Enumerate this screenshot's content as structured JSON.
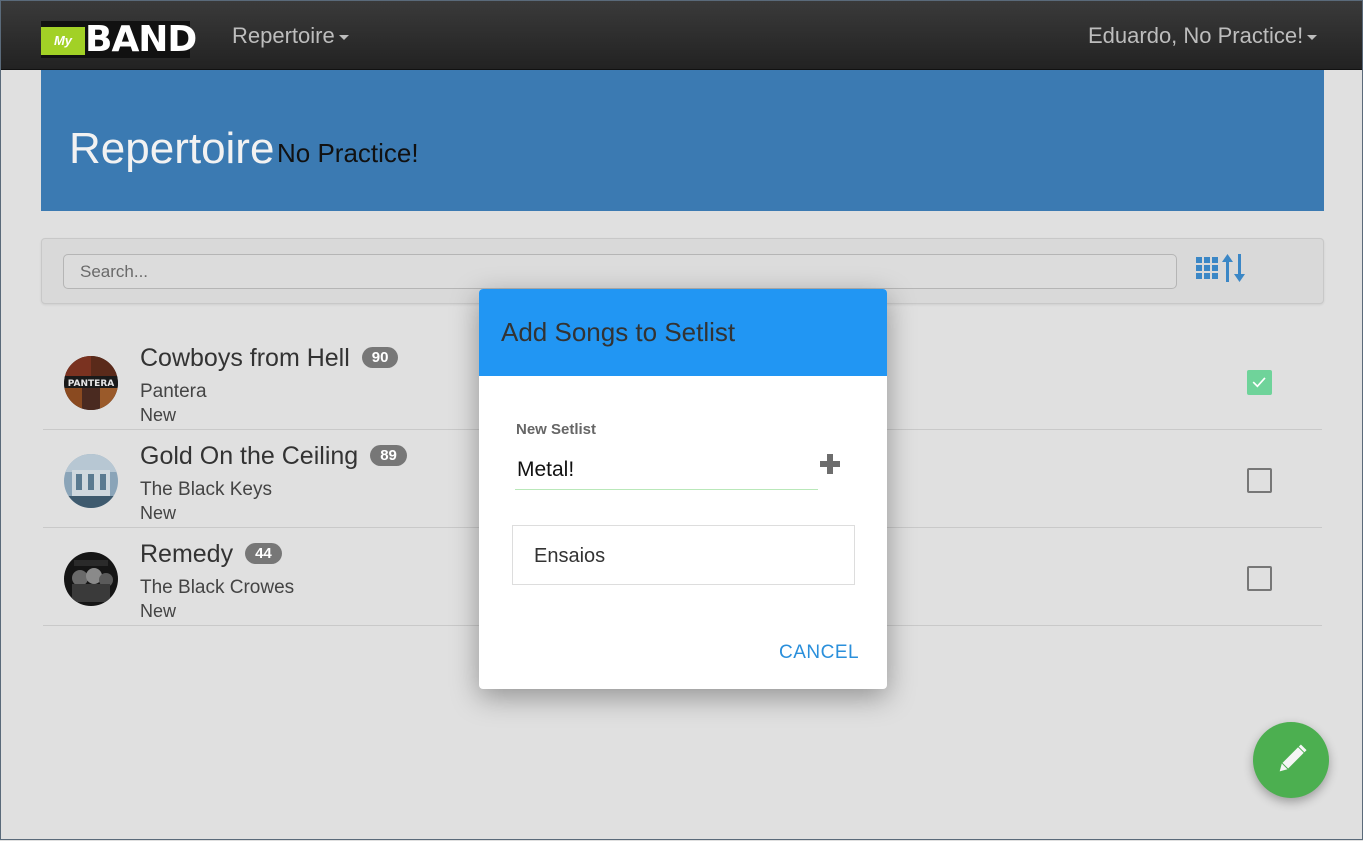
{
  "navbar": {
    "logo_my": "My",
    "logo_band": "BAND",
    "menu_repertoire": "Repertoire",
    "user_menu": "Eduardo, No Practice!"
  },
  "header": {
    "title": "Repertoire",
    "subtitle": "No Practice!"
  },
  "search": {
    "placeholder": "Search..."
  },
  "songs": [
    {
      "title": "Cowboys from Hell",
      "count": "90",
      "artist": "Pantera",
      "status": "New",
      "checked": true
    },
    {
      "title": "Gold On the Ceiling",
      "count": "89",
      "artist": "The Black Keys",
      "status": "New",
      "checked": false
    },
    {
      "title": "Remedy",
      "count": "44",
      "artist": "The Black Crowes",
      "status": "New",
      "checked": false
    }
  ],
  "modal": {
    "title": "Add Songs to Setlist",
    "new_setlist_label": "New Setlist",
    "new_setlist_value": "Metal!",
    "setlists": [
      "Ensaios"
    ],
    "cancel_label": "CANCEL"
  },
  "colors": {
    "navbar": "#2b2b2b",
    "header_bg": "#3b7ab2",
    "modal_header": "#2196f3",
    "fab": "#4caf50",
    "check": "#6fd39a",
    "accent_link": "#2a8fdb"
  },
  "icons": {
    "grid": "grid-view-icon",
    "sort": "sort-icon",
    "add": "plus-icon",
    "edit": "pencil-icon"
  }
}
